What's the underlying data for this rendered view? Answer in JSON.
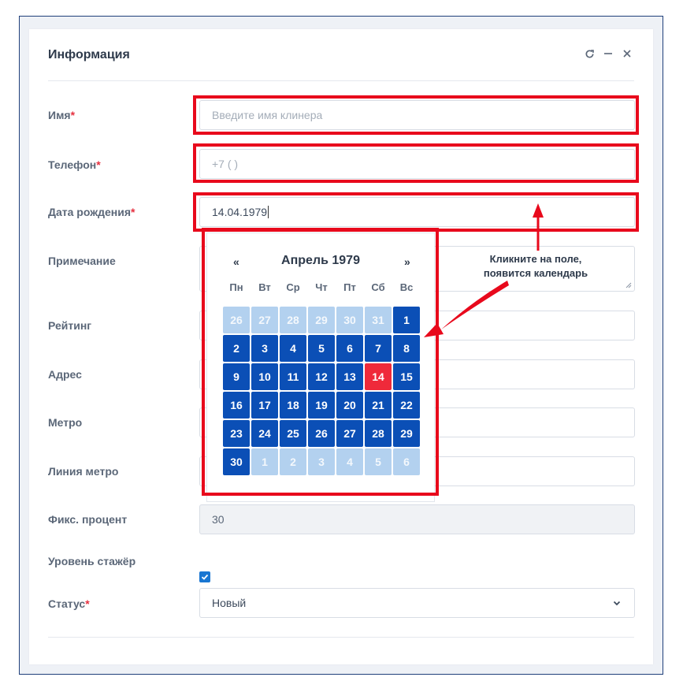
{
  "panel": {
    "title": "Информация",
    "tools": [
      "refresh-icon",
      "minimize-icon",
      "close-icon"
    ]
  },
  "form": {
    "name": {
      "label": "Имя",
      "required": "*",
      "placeholder": "Введите имя клинера"
    },
    "phone": {
      "label": "Телефон",
      "required": "*",
      "placeholder": "+7 (  )"
    },
    "birth": {
      "label": "Дата рождения",
      "required": "*",
      "value": "14.04.1979"
    },
    "note": {
      "label": "Примечание"
    },
    "rating": {
      "label": "Рейтинг"
    },
    "address": {
      "label": "Адрес"
    },
    "metro": {
      "label": "Метро"
    },
    "metro_line": {
      "label": "Линия метро"
    },
    "fixed_percent": {
      "label": "Фикс. процент",
      "value": "30"
    },
    "trainee": {
      "label": "Уровень стажёр",
      "checked": true
    },
    "status": {
      "label": "Статус",
      "required": "*",
      "value": "Новый"
    }
  },
  "calendar": {
    "prev": "«",
    "next": "»",
    "title": "Апрель 1979",
    "weekdays": [
      "Пн",
      "Вт",
      "Ср",
      "Чт",
      "Пт",
      "Сб",
      "Вс"
    ],
    "weeks": [
      [
        {
          "d": "26",
          "t": "other"
        },
        {
          "d": "27",
          "t": "other"
        },
        {
          "d": "28",
          "t": "other"
        },
        {
          "d": "29",
          "t": "other"
        },
        {
          "d": "30",
          "t": "other"
        },
        {
          "d": "31",
          "t": "other"
        },
        {
          "d": "1",
          "t": "cur"
        }
      ],
      [
        {
          "d": "2",
          "t": "cur"
        },
        {
          "d": "3",
          "t": "cur"
        },
        {
          "d": "4",
          "t": "cur"
        },
        {
          "d": "5",
          "t": "cur"
        },
        {
          "d": "6",
          "t": "cur"
        },
        {
          "d": "7",
          "t": "cur"
        },
        {
          "d": "8",
          "t": "cur"
        }
      ],
      [
        {
          "d": "9",
          "t": "cur"
        },
        {
          "d": "10",
          "t": "cur"
        },
        {
          "d": "11",
          "t": "cur"
        },
        {
          "d": "12",
          "t": "cur"
        },
        {
          "d": "13",
          "t": "cur"
        },
        {
          "d": "14",
          "t": "today"
        },
        {
          "d": "15",
          "t": "cur"
        }
      ],
      [
        {
          "d": "16",
          "t": "cur"
        },
        {
          "d": "17",
          "t": "cur"
        },
        {
          "d": "18",
          "t": "cur"
        },
        {
          "d": "19",
          "t": "cur"
        },
        {
          "d": "20",
          "t": "cur"
        },
        {
          "d": "21",
          "t": "cur"
        },
        {
          "d": "22",
          "t": "cur"
        }
      ],
      [
        {
          "d": "23",
          "t": "cur"
        },
        {
          "d": "24",
          "t": "cur"
        },
        {
          "d": "25",
          "t": "cur"
        },
        {
          "d": "26",
          "t": "cur"
        },
        {
          "d": "27",
          "t": "cur"
        },
        {
          "d": "28",
          "t": "cur"
        },
        {
          "d": "29",
          "t": "cur"
        }
      ],
      [
        {
          "d": "30",
          "t": "cur"
        },
        {
          "d": "1",
          "t": "other"
        },
        {
          "d": "2",
          "t": "other"
        },
        {
          "d": "3",
          "t": "other"
        },
        {
          "d": "4",
          "t": "other"
        },
        {
          "d": "5",
          "t": "other"
        },
        {
          "d": "6",
          "t": "other"
        }
      ]
    ]
  },
  "annotation": {
    "line1": "Кликните на поле,",
    "line2": "появится календарь"
  },
  "colors": {
    "highlight": "#e8091c",
    "day_current": "#0b4fb6",
    "day_other": "#b3d1ef",
    "day_today": "#ef2a3a",
    "checkbox": "#1976d2"
  }
}
